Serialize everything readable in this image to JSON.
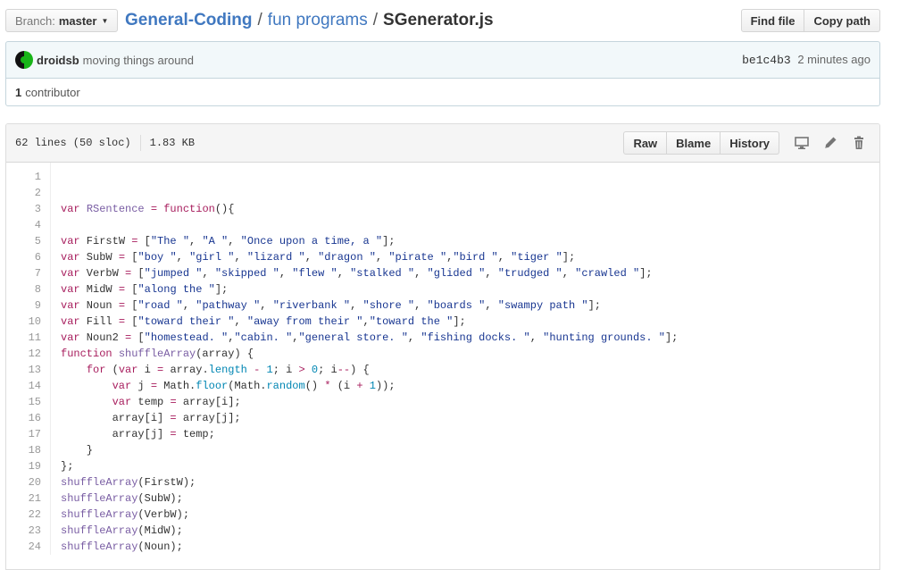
{
  "branch": {
    "label": "Branch:",
    "value": "master"
  },
  "breadcrumb": {
    "repo": "General-Coding",
    "dir": "fun programs",
    "file": "SGenerator.js",
    "sep": "/"
  },
  "top_actions": {
    "find_file": "Find file",
    "copy_path": "Copy path"
  },
  "commit": {
    "author": "droidsb",
    "message": "moving things around",
    "sha": "be1c4b3",
    "time": "2 minutes ago"
  },
  "contributors": {
    "count": "1",
    "label": "contributor"
  },
  "file": {
    "lines_info": "62 lines (50 sloc)",
    "size": "1.83 KB",
    "actions": {
      "raw": "Raw",
      "blame": "Blame",
      "history": "History"
    },
    "icons": [
      "desktop-icon",
      "pencil-icon",
      "trash-icon"
    ]
  },
  "code_lines": [
    {
      "n": "1",
      "t": ""
    },
    {
      "n": "2",
      "t": ""
    },
    {
      "n": "3",
      "t": "var RSentence = function(){"
    },
    {
      "n": "4",
      "t": ""
    },
    {
      "n": "5",
      "t": "var FirstW = [\"The \", \"A \", \"Once upon a time, a \"];"
    },
    {
      "n": "6",
      "t": "var SubW = [\"boy \", \"girl \", \"lizard \", \"dragon \", \"pirate \",\"bird \", \"tiger \"];"
    },
    {
      "n": "7",
      "t": "var VerbW = [\"jumped \", \"skipped \", \"flew \", \"stalked \", \"glided \", \"trudged \", \"crawled \"];"
    },
    {
      "n": "8",
      "t": "var MidW = [\"along the \"];"
    },
    {
      "n": "9",
      "t": "var Noun = [\"road \", \"pathway \", \"riverbank \", \"shore \", \"boards \", \"swampy path \"];"
    },
    {
      "n": "10",
      "t": "var Fill = [\"toward their \", \"away from their \",\"toward the \"];"
    },
    {
      "n": "11",
      "t": "var Noun2 = [\"homestead. \",\"cabin. \",\"general store. \", \"fishing docks. \", \"hunting grounds. \"];"
    },
    {
      "n": "12",
      "t": "function shuffleArray(array) {"
    },
    {
      "n": "13",
      "t": "    for (var i = array.length - 1; i > 0; i--) {"
    },
    {
      "n": "14",
      "t": "        var j = Math.floor(Math.random() * (i + 1));"
    },
    {
      "n": "15",
      "t": "        var temp = array[i];"
    },
    {
      "n": "16",
      "t": "        array[i] = array[j];"
    },
    {
      "n": "17",
      "t": "        array[j] = temp;"
    },
    {
      "n": "18",
      "t": "    }"
    },
    {
      "n": "19",
      "t": "};"
    },
    {
      "n": "20",
      "t": "shuffleArray(FirstW);"
    },
    {
      "n": "21",
      "t": "shuffleArray(SubW);"
    },
    {
      "n": "22",
      "t": "shuffleArray(VerbW);"
    },
    {
      "n": "23",
      "t": "shuffleArray(MidW);"
    },
    {
      "n": "24",
      "t": "shuffleArray(Noun);"
    }
  ],
  "colors": {
    "link": "#4078c0",
    "keyword": "#a71d5d",
    "function": "#795da3",
    "string": "#183691",
    "constant": "#0086b3",
    "commit_bg": "#f2f8fa"
  }
}
